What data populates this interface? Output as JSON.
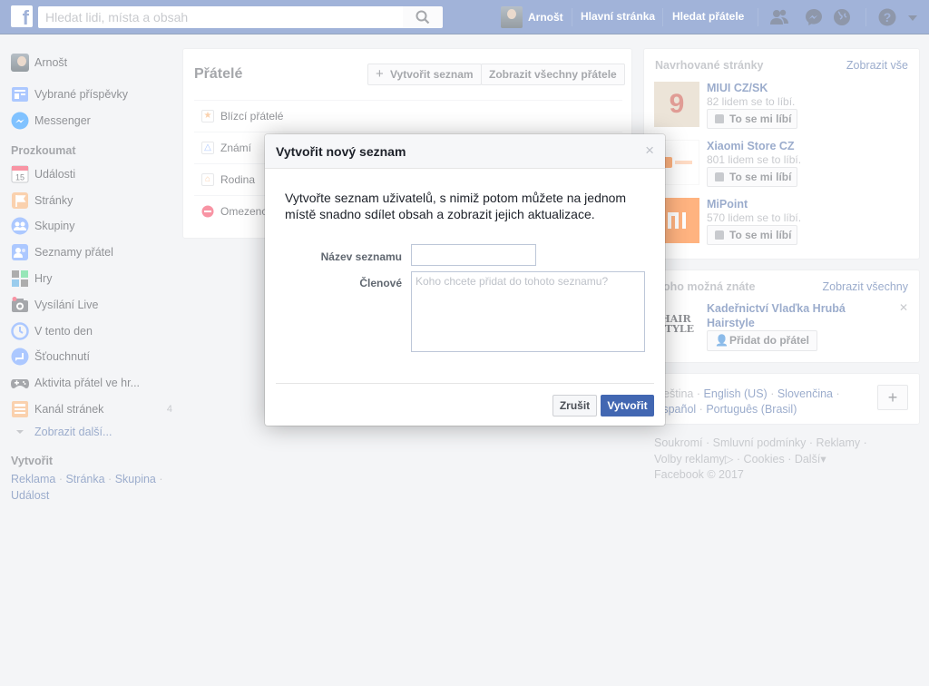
{
  "topbar": {
    "search_placeholder": "Hledat lidi, místa a obsah",
    "user_name": "Arnošt",
    "home": "Hlavní stránka",
    "find_friends": "Hledat přátele",
    "brand_color": "#4267b2"
  },
  "leftnav": {
    "profile": "Arnošt",
    "items_top": [
      "Vybrané příspěvky",
      "Messenger"
    ],
    "explore_heading": "Prozkoumat",
    "explore": [
      {
        "label": "Události",
        "icon": "calendar-icon",
        "color": "#e9ebee"
      },
      {
        "label": "Stránky",
        "icon": "flag-icon",
        "color": "#f5a35c"
      },
      {
        "label": "Skupiny",
        "icon": "groups-icon",
        "color": "#5890ff"
      },
      {
        "label": "Seznamy přátel",
        "icon": "friend-list-icon",
        "color": "#5890ff"
      },
      {
        "label": "Hry",
        "icon": "games-icon",
        "color": "#5b5b5b"
      },
      {
        "label": "Vysílání Live",
        "icon": "live-camera-icon",
        "color": "#4b4f56"
      },
      {
        "label": "V tento den",
        "icon": "clock-icon",
        "color": "#5890ff"
      },
      {
        "label": "Šťouchnutí",
        "icon": "poke-icon",
        "color": "#5890ff"
      },
      {
        "label": "Aktivita přátel ve hr...",
        "icon": "gamepad-icon",
        "color": "#4b4f56"
      },
      {
        "label": "Kanál stránek",
        "icon": "page-feed-icon",
        "color": "#f5a35c",
        "count": "4"
      }
    ],
    "calendar_day": "15",
    "show_more": "Zobrazit další...",
    "create_heading": "Vytvořit",
    "create_links": [
      "Reklama",
      "Stránka",
      "Skupina",
      "Událost"
    ]
  },
  "friends": {
    "title": "Přátelé",
    "create_list": "Vytvořit seznam",
    "show_all": "Zobrazit všechny přátele",
    "lists": [
      "Blízcí přátelé",
      "Známí",
      "Rodina",
      "Omezeno"
    ]
  },
  "suggested": {
    "heading": "Navrhované stránky",
    "show_all": "Zobrazit vše",
    "like_label": "To se mi líbí",
    "pages": [
      {
        "name": "MIUI CZ/SK",
        "likes": "82 lidem se to líbí."
      },
      {
        "name": "Xiaomi Store CZ",
        "likes": "801 lidem se to líbí."
      },
      {
        "name": "MiPoint",
        "likes": "570 lidem se to líbí."
      }
    ]
  },
  "people": {
    "heading": "Koho možná znáte",
    "show_all": "Zobrazit všechny",
    "name": "Kadeřnictví Vlaďka Hrubá Hairstyle",
    "add_label": "Přidat do přátel"
  },
  "languages": {
    "current": "Čeština",
    "others": [
      "English (US)",
      "Slovenčina",
      "Español",
      "Português (Brasil)"
    ]
  },
  "footer": {
    "links": [
      "Soukromí",
      "Smluvní podmínky",
      "Reklamy",
      "Volby reklamy",
      "Cookies",
      "Další"
    ],
    "copyright": "Facebook © 2017"
  },
  "dialog": {
    "title": "Vytvořit nový seznam",
    "intro": "Vytvořte seznam uživatelů, s nimiž potom můžete na jednom místě snadno sdílet obsah a zobrazit jejich aktualizace.",
    "name_label": "Název seznamu",
    "name_value": "",
    "members_label": "Členové",
    "members_placeholder": "Koho chcete přidat do tohoto seznamu?",
    "cancel": "Zrušit",
    "create": "Vytvořit"
  }
}
